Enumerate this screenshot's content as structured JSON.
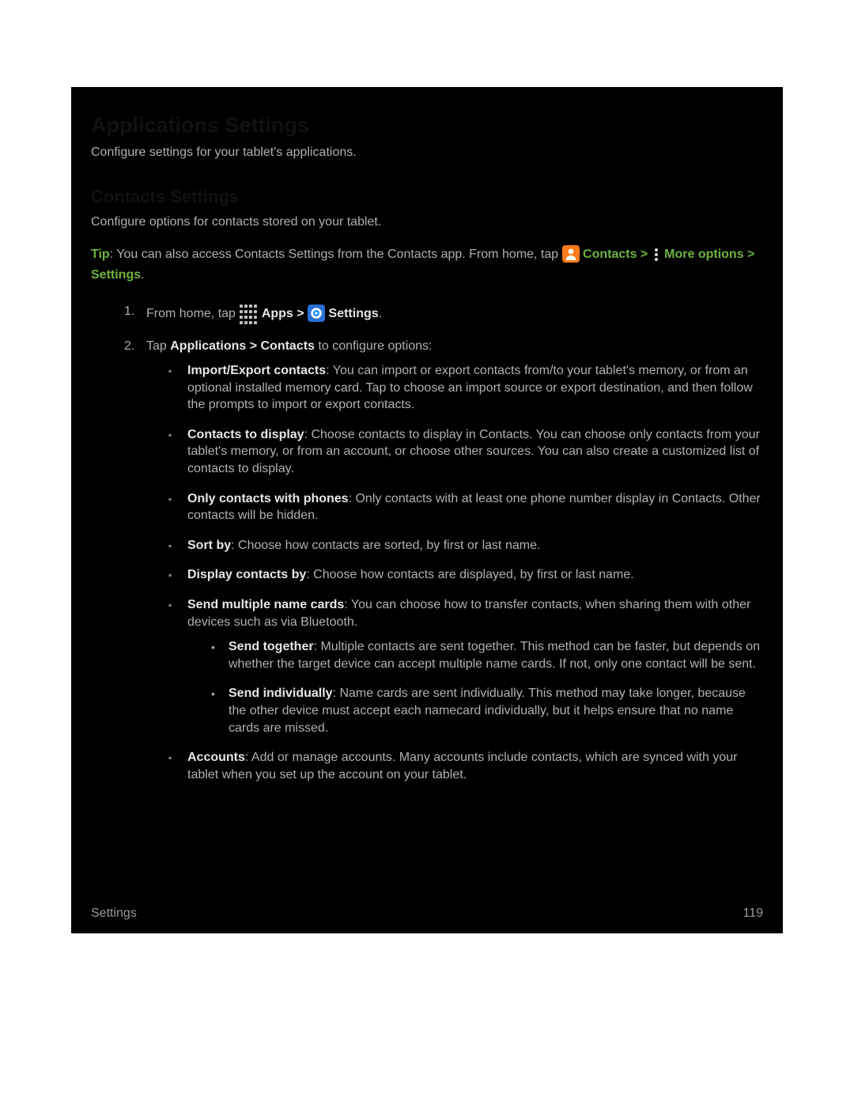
{
  "heading_main": "Applications Settings",
  "intro_main": "Configure settings for your tablet's applications.",
  "heading_sub": "Contacts Settings",
  "intro_sub": "Configure options for contacts stored on your tablet.",
  "tip": {
    "label": "Tip",
    "lead": ": You can also access Contacts Settings from the Contacts app. From home, tap ",
    "contacts": "Contacts > ",
    "more": "More options > Settings",
    "period": "."
  },
  "steps": [
    {
      "num": "1.",
      "pre": "From home, tap ",
      "apps": "Apps > ",
      "settings": "Settings",
      "post": "."
    },
    {
      "num": "2.",
      "pre": "Tap ",
      "b1": "Applications",
      "mid": " > ",
      "b2": "Contacts",
      "post": " to configure options:"
    }
  ],
  "options": [
    {
      "b": "Import/Export contacts",
      "t": ": You can import or export contacts from/to your tablet's memory, or from an optional installed memory card. Tap to choose an import source or export destination, and then follow the prompts to import or export contacts."
    },
    {
      "b": "Contacts to display",
      "t": ": Choose contacts to display in Contacts. You can choose only contacts from your tablet's memory, or from an account, or choose other sources. You can also create a customized list of contacts to display."
    },
    {
      "b": "Only contacts with phones",
      "t": ": Only contacts with at least one phone number display in Contacts. Other contacts will be hidden."
    },
    {
      "b": "Sort by",
      "t": ": Choose how contacts are sorted, by first or last name."
    },
    {
      "b": "Display contacts by",
      "t": ": Choose how contacts are displayed, by first or last name."
    },
    {
      "b": "Send multiple name cards",
      "t": ": You can choose how to transfer contacts, when sharing them with other devices such as via Bluetooth.",
      "sub": [
        {
          "b": "Send together",
          "t": ": Multiple contacts are sent together. This method can be faster, but depends on whether the target device can accept multiple name cards. If not, only one contact will be sent."
        },
        {
          "b": "Send individually",
          "t": ": Name cards are sent individually. This method may take longer, because the other device must accept each namecard individually, but it helps ensure that no name cards are missed."
        }
      ]
    },
    {
      "b": "Accounts",
      "t": ": Add or manage accounts. Many accounts include contacts, which are synced with your tablet when you set up the account on your tablet."
    }
  ],
  "footer": {
    "left": "Settings",
    "right": "119"
  }
}
